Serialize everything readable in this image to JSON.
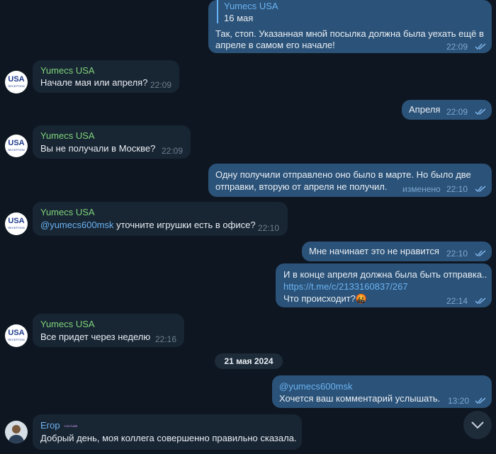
{
  "messages": {
    "m1": {
      "reply_name": "Yumecs USA",
      "reply_text": "16 мая",
      "text1": "Так, стоп. Указанная мной посылка должна была уехать ещё в",
      "text2": "апреле в самом его начале!",
      "time": "22:09"
    },
    "m2": {
      "sender": "Yumecs USA",
      "text": "Начале мая или апреля?",
      "time": "22:09"
    },
    "m3": {
      "text": "Апреля",
      "time": "22:09"
    },
    "m4": {
      "sender": "Yumecs USA",
      "text": "Вы не получали в Москве?",
      "time": "22:09"
    },
    "m5": {
      "text1": "Одну получили отправлено оно было в марте. Но было две",
      "text2": "отправки, вторую от апреля не получил.",
      "edited": "изменено",
      "time": "22:10"
    },
    "m6": {
      "sender": "Yumecs USA",
      "mention": "@yumecs600msk",
      "text": " уточните игрушки есть в офисе?",
      "time": "22:10"
    },
    "m7": {
      "text": "Мне начинает это не нравится",
      "time": "22:10"
    },
    "m8": {
      "text1": "И в конце апреля должна была быть отправка..",
      "link": "https://t.me/c/2133160837/267",
      "text3": "Что происходит?",
      "emoji": "🤬",
      "time": "22:14"
    },
    "m9": {
      "sender": "Yumecs USA",
      "text": "Все придет через неделю",
      "time": "22:16"
    },
    "m10": {
      "mention": "@yumecs600msk",
      "text": "Хочется ваш комментарий услышать.",
      "time": "13:20"
    },
    "m11": {
      "sender": "Егор",
      "badge": "YOUTUBE",
      "text": "Добрый день, моя коллега совершенно правильно сказала."
    }
  },
  "date_separator": "21 мая 2024",
  "avatar_text": {
    "usa": "USA",
    "sub": "RECEPTION"
  },
  "colors": {
    "bg": "#0e1621",
    "incoming": "#182533",
    "outgoing": "#2b5278",
    "name": "#7fd37a",
    "link": "#6ab3f3"
  }
}
